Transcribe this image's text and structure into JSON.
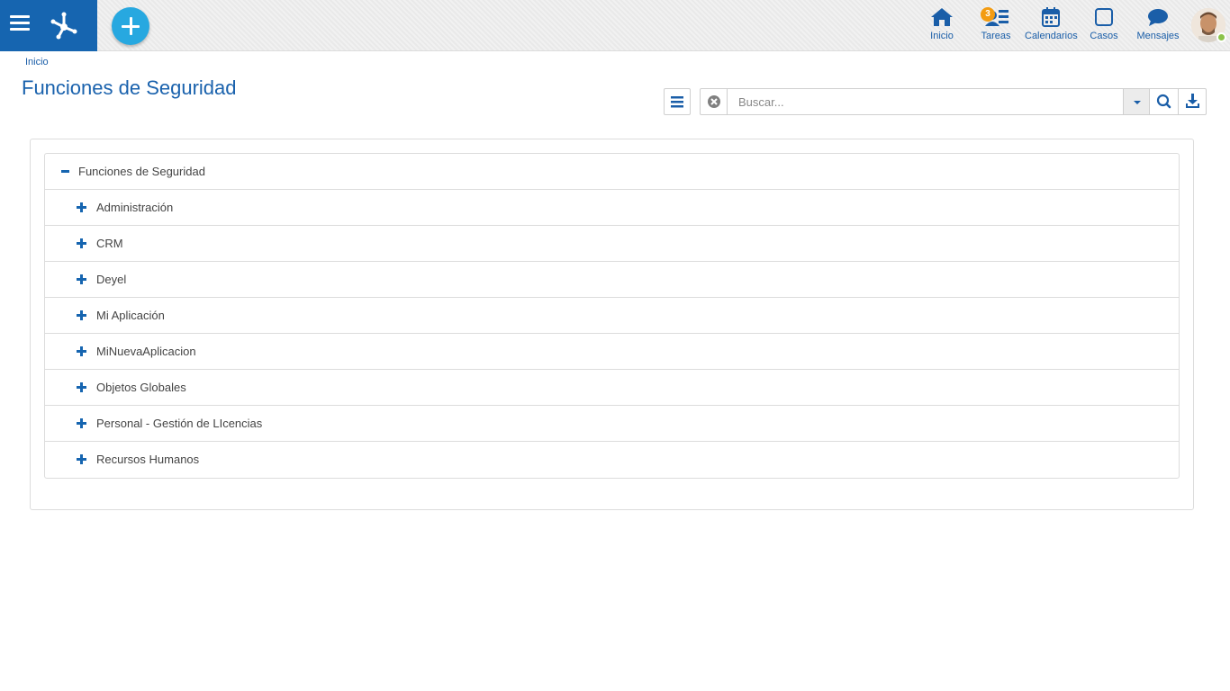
{
  "header": {
    "nav": [
      {
        "label": "Inicio",
        "icon": "home-icon"
      },
      {
        "label": "Tareas",
        "icon": "tasks-icon",
        "badge": "3"
      },
      {
        "label": "Calendarios",
        "icon": "calendar-icon"
      },
      {
        "label": "Casos",
        "icon": "cases-icon"
      },
      {
        "label": "Mensajes",
        "icon": "messages-icon"
      }
    ],
    "accent_color": "#1665b0",
    "add_button_color": "#27a8e0",
    "badge_color": "#f39c12",
    "status_color": "#8bc34a"
  },
  "breadcrumb": "Inicio",
  "page_title": "Funciones de Seguridad",
  "search": {
    "placeholder": "Buscar..."
  },
  "tree": {
    "root": {
      "label": "Funciones de Seguridad",
      "expanded": true
    },
    "children": [
      {
        "label": "Administración"
      },
      {
        "label": "CRM"
      },
      {
        "label": "Deyel"
      },
      {
        "label": "Mi Aplicación"
      },
      {
        "label": "MiNuevaAplicacion"
      },
      {
        "label": "Objetos Globales"
      },
      {
        "label": "Personal - Gestión de LIcencias"
      },
      {
        "label": "Recursos Humanos"
      }
    ]
  }
}
